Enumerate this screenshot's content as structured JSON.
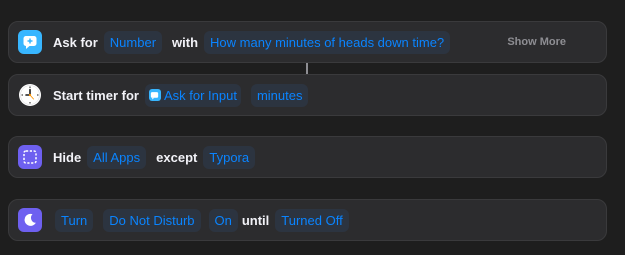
{
  "actions": {
    "ask": {
      "icon": "ask-for-input-icon",
      "label": "Ask for",
      "type_token": "Number",
      "with_label": "with",
      "prompt_token": "How many minutes of heads down time?",
      "show_more": "Show More"
    },
    "timer": {
      "icon": "clock-icon",
      "label": "Start timer for",
      "input_token": "Ask for Input",
      "unit_token": "minutes"
    },
    "hide": {
      "icon": "hide-apps-icon",
      "label": "Hide",
      "apps_token": "All Apps",
      "except_label": "except",
      "app_token": "Typora"
    },
    "focus": {
      "icon": "moon-icon",
      "turn_token": "Turn",
      "mode_token": "Do Not Disturb",
      "state_token": "On",
      "until_label": "until",
      "until_token": "Turned Off"
    }
  },
  "colors": {
    "background": "#1e1e1e",
    "card": "#2c2c2e",
    "token_text": "#0a84ff",
    "ask_icon": "#38b6ff",
    "purple_icon": "#6e60f0"
  }
}
